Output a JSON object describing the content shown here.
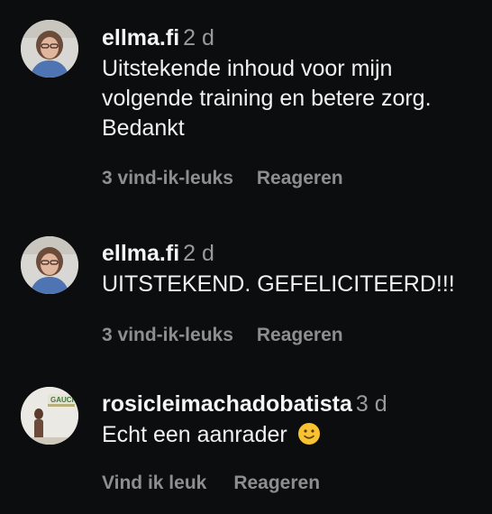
{
  "comments": [
    {
      "username": "ellma.fi",
      "time": "2 d",
      "text": "Uitstekende inhoud voor mijn volgende training en betere zorg. Bedankt",
      "likes_label": "3 vind-ik-leuks",
      "reply_label": "Reageren",
      "avatar_icon": "profile-photo"
    },
    {
      "username": "ellma.fi",
      "time": "2 d",
      "text": "UITSTEKEND. GEFELICITEERD!!!",
      "likes_label": "3 vind-ik-leuks",
      "reply_label": "Reageren",
      "avatar_icon": "profile-photo"
    },
    {
      "username": "rosicleimachadobatista",
      "time": "3 d",
      "text": "Echt een aanrader",
      "emoji": "slightly-smiling-face-icon",
      "likes_label": "Vind ik leuk",
      "reply_label": "Reageren",
      "avatar_icon": "profile-photo"
    }
  ],
  "colors": {
    "background": "#0c0d0f",
    "text": "#f2f2f2",
    "muted": "#9a9a9a"
  }
}
